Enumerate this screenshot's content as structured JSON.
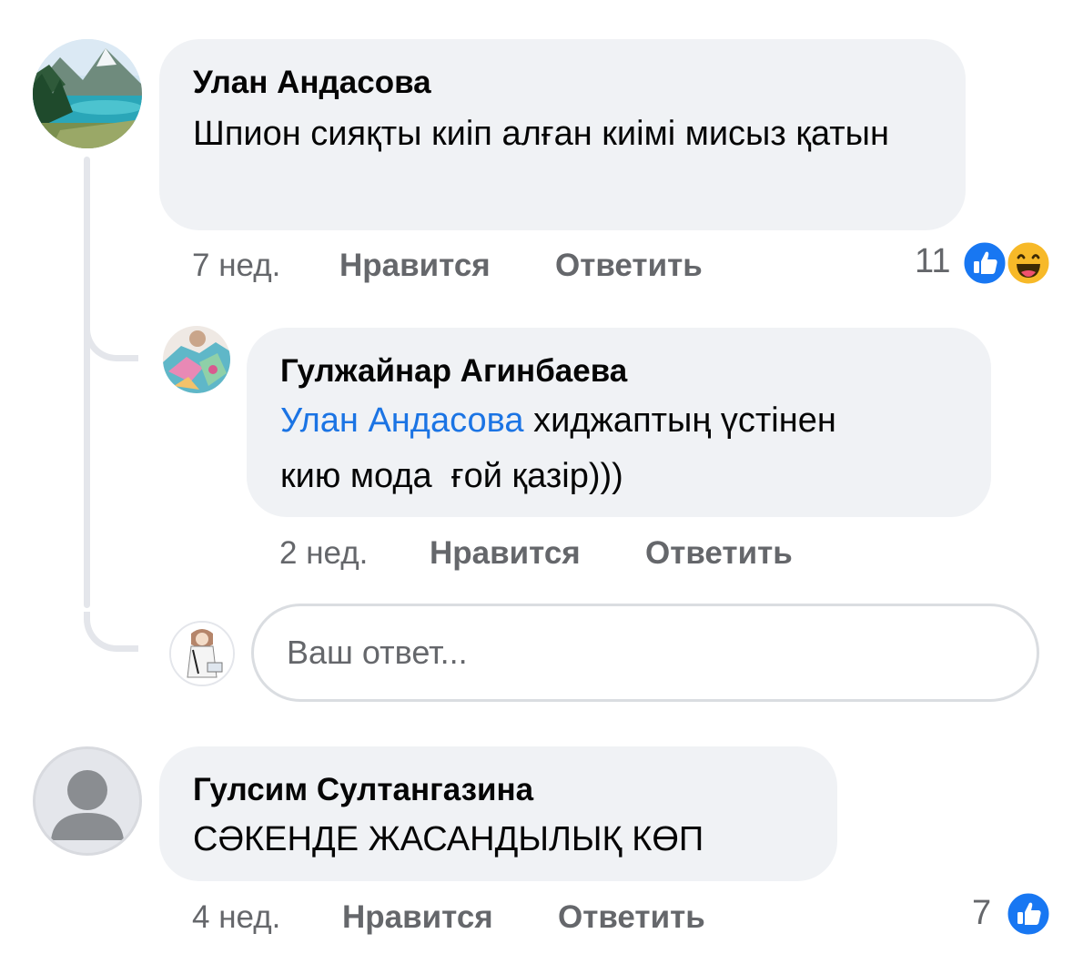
{
  "comments": [
    {
      "author": "Улан Андасова",
      "text": "Шпион сияқты киіп алған киімі мисыз қатын",
      "time": "7 нед.",
      "like_label": "Нравится",
      "reply_label": "Ответить",
      "reaction_count": "11",
      "reaction_icons": [
        "like-icon",
        "haha-icon"
      ],
      "avatar": "landscape-lake-photo",
      "replies": [
        {
          "author": "Гулжайнар Агинбаева",
          "mention": "Улан Андасова",
          "text": "хиджаптың үстінен киюмода ғой қазір)))",
          "text_line1": "хиджаптың үстінен",
          "text_line2": "кию мода  ғой қазір)))",
          "time": "2 нед.",
          "like_label": "Нравится",
          "reply_label": "Ответить",
          "avatar": "colorful-scarf-photo"
        }
      ]
    },
    {
      "author": "Гулсим Султангазина",
      "text": "СӘКЕНДЕ ЖАСАНДЫЛЫҚ КӨП",
      "time": "4 нед.",
      "like_label": "Нравится",
      "reply_label": "Ответить",
      "reaction_count": "7",
      "reaction_icons": [
        "like-icon"
      ],
      "avatar": "default-user-silhouette"
    }
  ],
  "reply_box": {
    "placeholder": "Ваш ответ...",
    "value": "",
    "avatar": "current-user-illustration"
  },
  "colors": {
    "bubble": "#f0f2f5",
    "meta_text": "#65676b",
    "mention": "#1b74e4",
    "like_blue": "#1877f2",
    "haha_yellow": "#f7b928",
    "thread_line": "#e4e6eb"
  }
}
